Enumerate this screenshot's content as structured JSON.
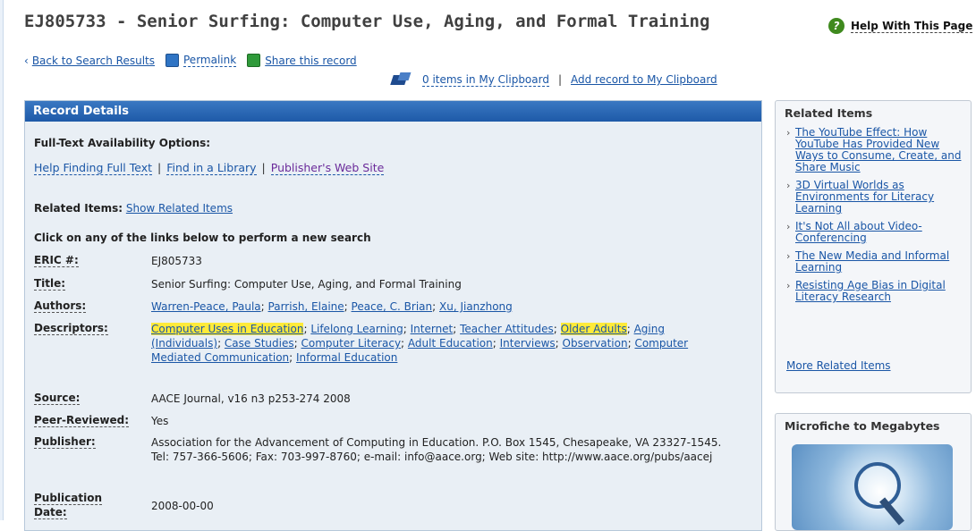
{
  "header": {
    "title": "EJ805733 - Senior Surfing: Computer Use, Aging, and Formal Training",
    "help_label": "Help With This Page"
  },
  "nav": {
    "back_label": "Back to Search Results",
    "permalink_label": "Permalink",
    "share_label": "Share this record"
  },
  "clipboard": {
    "count_label": "0 items in My Clipboard",
    "separator": "|",
    "add_label": "Add record to My Clipboard"
  },
  "details": {
    "heading": "Record Details",
    "fulltext_heading": "Full-Text Availability Options:",
    "fulltext_links": [
      "Help Finding Full Text",
      "Find in a Library",
      "Publisher's Web Site"
    ],
    "fulltext_sep": "|",
    "related_label": "Related Items:",
    "related_link": "Show Related Items",
    "click_instruction": "Click on any of the links below to perform a new search",
    "fields": {
      "eric_label": "ERIC #:",
      "eric_value": "EJ805733",
      "title_label": "Title:",
      "title_value": "Senior Surfing: Computer Use, Aging, and Formal Training",
      "authors_label": "Authors:",
      "authors": [
        "Warren-Peace, Paula",
        "Parrish, Elaine",
        "Peace, C. Brian",
        "Xu, Jianzhong"
      ],
      "descriptors_label": "Descriptors:",
      "descriptors": [
        "Computer Uses in Education",
        "Lifelong Learning",
        "Internet",
        "Teacher Attitudes",
        "Older Adults",
        "Aging (Individuals)",
        "Case Studies",
        "Computer Literacy",
        "Adult Education",
        "Interviews",
        "Observation",
        "Computer Mediated Communication",
        "Informal Education"
      ],
      "source_label": "Source:",
      "source_value": "AACE Journal, v16 n3 p253-274 2008",
      "peer_label": "Peer-Reviewed:",
      "peer_value": "Yes",
      "publisher_label": "Publisher:",
      "publisher_value": "Association for the Advancement of Computing in Education. P.O. Box 1545, Chesapeake, VA 23327-1545. Tel: 757-366-5606; Fax: 703-997-8760; e-mail: info@aace.org; Web site: http://www.aace.org/pubs/aacej",
      "pubdate_label": "Publication Date:",
      "pubdate_value": "2008-00-00"
    }
  },
  "sidebar": {
    "related_heading": "Related Items",
    "related_items": [
      "The YouTube Effect: How YouTube Has Provided New Ways to Consume, Create, and Share Music",
      "3D Virtual Worlds as Environments for Literacy Learning",
      "It's Not All about Video-Conferencing",
      "The New Media and Informal Learning",
      "Resisting Age Bias in Digital Literacy Research"
    ],
    "more_label": "More Related Items",
    "promo_heading": "Microfiche to Megabytes"
  }
}
